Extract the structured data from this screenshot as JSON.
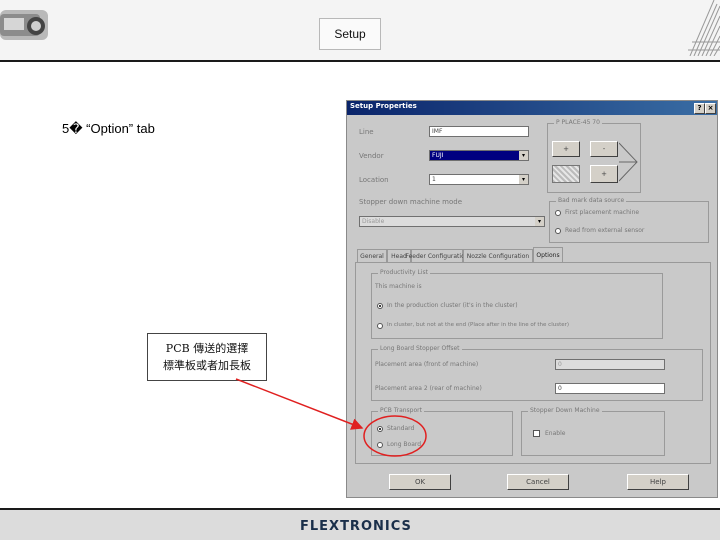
{
  "slide": {
    "header_title": "Setup",
    "bullet": "5�  “Option” tab",
    "callout": {
      "line1": "PCB 傳送的選擇",
      "line2": "標準板或者加長板"
    },
    "footer_brand": "FLEXTRONICS"
  },
  "dialog": {
    "title": "Setup Properties",
    "help_btn": "?",
    "close_btn": "×",
    "line_label": "Line",
    "line_value": "IMF",
    "vendor_label": "Vendor",
    "vendor_value": "FUJI",
    "location_label": "Location",
    "location_value": "1",
    "stopper_group_label": "Stopper down machine mode",
    "stopper_value": "Disable",
    "place_group_label": "P PLACE-45 70",
    "place_btn_plus": "+",
    "place_btn_minus": "-",
    "bad_mark_label": "Bad mark data source",
    "bad_mark_opt1": "First placement machine",
    "bad_mark_opt2": "Read from external sensor",
    "tabs": [
      "General",
      "Head",
      "Feeder Configuration",
      "Nozzle Configuration",
      "Options"
    ],
    "productivity_label": "Productivity List",
    "this_machine_label": "This machine is",
    "prod_opt1": "In the production cluster (it's in the cluster)",
    "prod_opt2": "In cluster, but not at the end (Place after in the line of the cluster)",
    "long_board_label": "Long Board Stopper Offset",
    "placement_area1_label": "Placement area     (front of machine)",
    "placement_area1_value": "0",
    "placement_area2_label": "Placement area 2 (rear of machine)",
    "placement_area2_value": "0",
    "pcb_transport_label": "PCB Transport",
    "transport_opt1": "Standard",
    "transport_opt2": "Long Board",
    "stopper_machine_label": "Stopper Down Machine",
    "enable_label": "Enable",
    "ok_btn": "OK",
    "cancel_btn": "Cancel",
    "help_bottom_btn": "Help"
  },
  "colors": {
    "titlebar": "#0a246a",
    "annotation": "#e02020",
    "brand": "#1a2f4a"
  }
}
